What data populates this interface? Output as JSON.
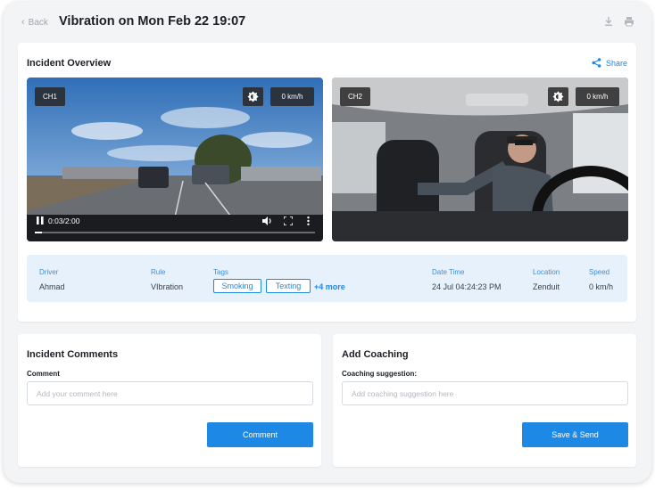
{
  "header": {
    "back_label": "Back",
    "title": "Vibration on Mon Feb 22 19:07",
    "download_icon": "download-icon",
    "print_icon": "print-icon"
  },
  "overview": {
    "title": "Incident Overview",
    "share_label": "Share",
    "videos": [
      {
        "channel": "CH1",
        "speed": "0 km/h",
        "time": "0:03/2:00",
        "progress": 0.025
      },
      {
        "channel": "CH2",
        "speed": "0 km/h"
      }
    ],
    "info": {
      "driver_label": "Driver",
      "driver": "Ahmad",
      "rule_label": "Rule",
      "rule": "VIbration",
      "tags_label": "Tags",
      "tags": [
        "Smoking",
        "Texting"
      ],
      "more_tags": "+4 more",
      "datetime_label": "Date Time",
      "datetime": "24 Jul 04:24:23 PM",
      "location_label": "Location",
      "location": "Zenduit",
      "speed_label": "Speed",
      "speed": "0 km/h"
    }
  },
  "comments": {
    "title": "Incident Comments",
    "field_label": "Comment",
    "placeholder": "Add your comment here",
    "button": "Comment"
  },
  "coaching": {
    "title": "Add Coaching",
    "field_label": "Coaching suggestion:",
    "placeholder": "Add coaching suggestion here",
    "button": "Save & Send"
  },
  "colors": {
    "accent": "#1e88e5",
    "info_bg": "#e6f1fb",
    "page_bg": "#f3f4f6"
  }
}
